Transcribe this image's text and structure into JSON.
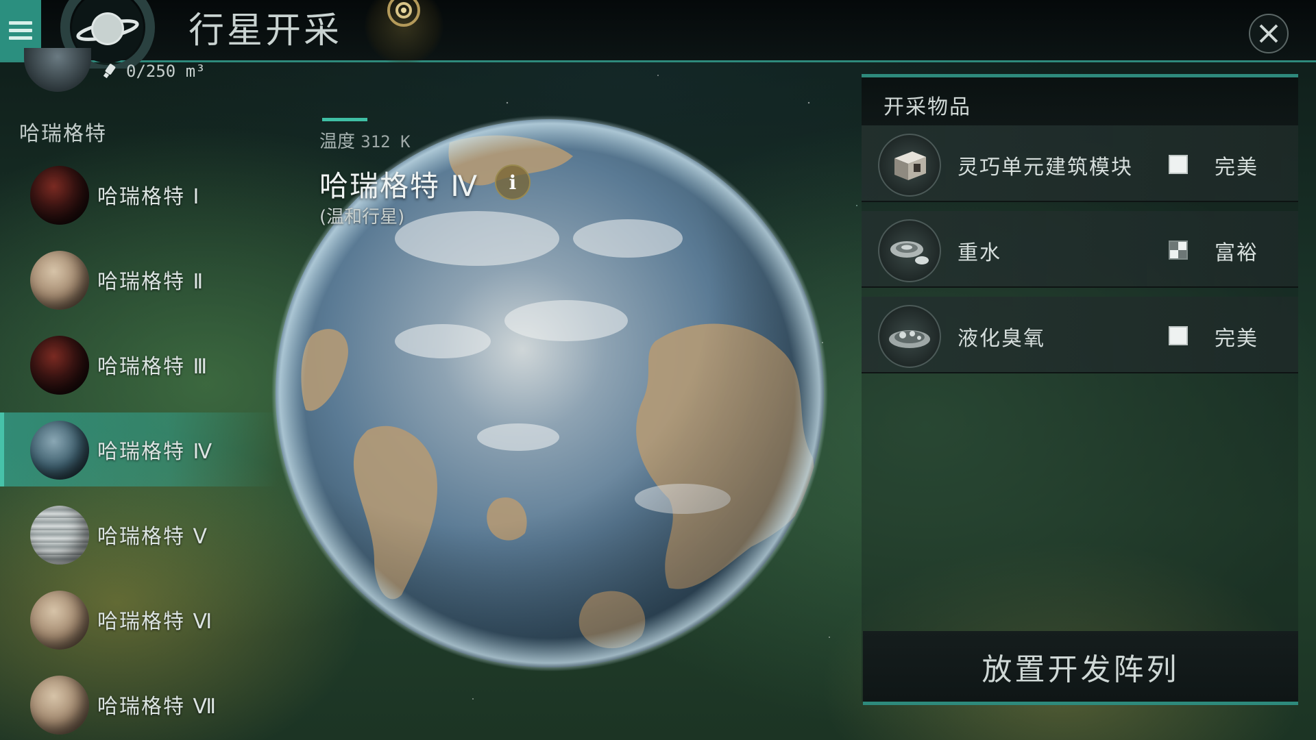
{
  "header": {
    "title": "行星开采",
    "menu_icon": "hamburger-menu-icon",
    "emblem_icon": "planet-ring-icon",
    "scan_icon": "scan-target-icon",
    "close_icon": "close-icon"
  },
  "capacity": {
    "text": "0/250 m³",
    "icon": "probe-icon"
  },
  "sidebar": {
    "system_name": "哈瑞格特",
    "planets": [
      {
        "label": "哈瑞格特 Ⅰ",
        "kind": "lava"
      },
      {
        "label": "哈瑞格特 Ⅱ",
        "kind": "barren"
      },
      {
        "label": "哈瑞格特 Ⅲ",
        "kind": "lava"
      },
      {
        "label": "哈瑞格特 Ⅳ",
        "kind": "temperate",
        "selected": true
      },
      {
        "label": "哈瑞格特 Ⅴ",
        "kind": "gas"
      },
      {
        "label": "哈瑞格特 Ⅵ",
        "kind": "barren"
      },
      {
        "label": "哈瑞格特 Ⅶ",
        "kind": "barren"
      }
    ]
  },
  "planet_info": {
    "temp_label": "温度",
    "temp_value": "312 K",
    "name": "哈瑞格特 Ⅳ",
    "type": "(温和行星)"
  },
  "mining_panel": {
    "title": "开采物品",
    "resources": [
      {
        "name": "灵巧单元建筑模块",
        "quality": "完美",
        "icon": "construction-block-icon"
      },
      {
        "name": "重水",
        "quality": "富裕",
        "icon": "heavy-water-icon"
      },
      {
        "name": "液化臭氧",
        "quality": "完美",
        "icon": "liquid-ozone-icon"
      }
    ],
    "deploy_label": "放置开发阵列"
  },
  "colors": {
    "accent": "#2e8a7c",
    "highlight": "#47c2a9"
  }
}
